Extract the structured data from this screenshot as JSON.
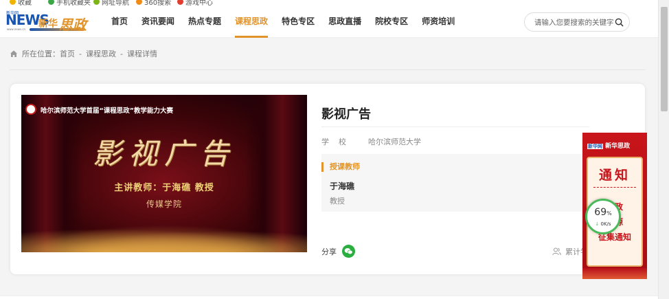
{
  "bookmarks": [
    {
      "label": "收藏",
      "color": "#f0b400"
    },
    {
      "label": "手机收藏夹",
      "color": "#3aa646"
    },
    {
      "label": "网址导航",
      "color": "#7cb518"
    },
    {
      "label": "360搜索",
      "color": "#f28a16"
    },
    {
      "label": "游戏中心",
      "color": "#e33d2f"
    }
  ],
  "logo": {
    "news_small": "新华网",
    "news_big": "NEWS",
    "url": "www.news.cn",
    "xinhua": "新华",
    "sizheng": "思政"
  },
  "nav": {
    "items": [
      {
        "label": "首页"
      },
      {
        "label": "资讯要闻"
      },
      {
        "label": "热点专题"
      },
      {
        "label": "课程思政",
        "active": true
      },
      {
        "label": "特色专区"
      },
      {
        "label": "思政直播"
      },
      {
        "label": "院校专区"
      },
      {
        "label": "师资培训"
      }
    ]
  },
  "search": {
    "placeholder": "请输入您要搜索的关键字"
  },
  "breadcrumb": {
    "prefix": "所在位置：",
    "items": [
      "首页",
      "课程思政",
      "课程详情"
    ],
    "separator": "-"
  },
  "video": {
    "top_text": "哈尔滨师范大学首届“课程思政”教学能力大赛",
    "title": "影视广告",
    "teacher": "主讲教师：于海礁 教授",
    "college": "传媒学院"
  },
  "course": {
    "title": "影视广告",
    "school_label": "学校",
    "school_value": "哈尔滨师范大学",
    "teacher_heading": "授课教师",
    "teacher_name": "于海礁",
    "teacher_rank": "教授",
    "share_label": "分享",
    "count_label": "累计学习"
  },
  "ad": {
    "logo_badge": "新华网",
    "logo_text": "新华思政",
    "heading": "通知",
    "lines": [
      "思政",
      "资源",
      "征集通知"
    ]
  },
  "speed_widget": {
    "percent": "69",
    "percent_unit": "%",
    "rate": "0K/s"
  },
  "colors": {
    "accent": "#e2942a",
    "brand_blue": "#1a56b0",
    "ad_red": "#c8151b",
    "speed_green": "#49b95a"
  }
}
